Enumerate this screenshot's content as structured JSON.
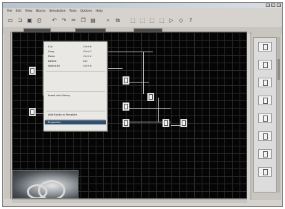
{
  "window": {
    "title": ""
  },
  "menubar": {
    "items": [
      "File",
      "Edit",
      "View",
      "Blocks",
      "Simulation",
      "Tools",
      "Options",
      "Help"
    ]
  },
  "toolbar": {
    "icons": [
      "new-icon",
      "open-icon",
      "save-icon",
      "print-icon",
      "undo-icon",
      "redo-icon",
      "cut-icon",
      "copy-icon",
      "paste-icon",
      "zoom-icon",
      "block-icon",
      "block-icon",
      "block-icon",
      "block-icon",
      "block-icon",
      "run-icon",
      "stop-icon",
      "help-icon"
    ]
  },
  "context_menu": {
    "items": [
      {
        "label": "Cut",
        "shortcut": "Ctrl+X",
        "enabled": true
      },
      {
        "label": "Copy",
        "shortcut": "Ctrl+C",
        "enabled": true
      },
      {
        "label": "Paste",
        "shortcut": "Ctrl+V",
        "enabled": true
      },
      {
        "label": "Delete",
        "shortcut": "Del",
        "enabled": true
      },
      {
        "label": "Select All",
        "shortcut": "Ctrl+A",
        "enabled": true
      }
    ],
    "dim_items": [
      "",
      "",
      ""
    ],
    "extra_items": [
      "Insert Into Library",
      ""
    ],
    "bottom_items": [
      "Add Blocks to Template"
    ],
    "highlighted": "Properties"
  },
  "colors": {
    "canvas": "#050505",
    "grid": "#2a2a2a",
    "menu_highlight": "#30506e"
  }
}
